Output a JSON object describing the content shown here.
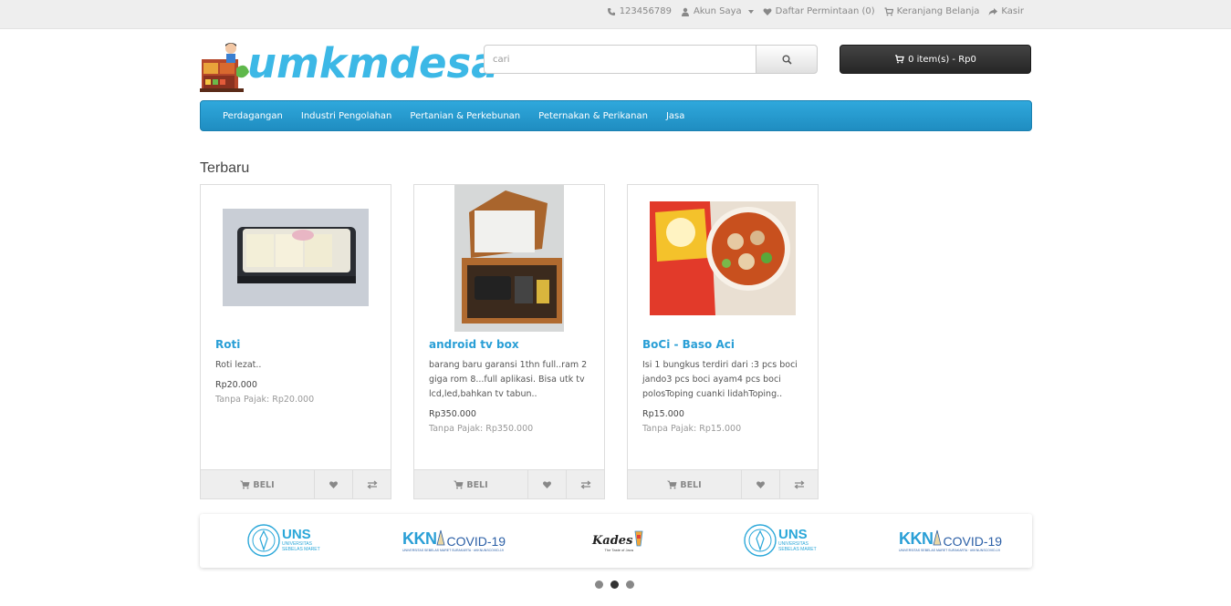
{
  "topbar": {
    "phone": "123456789",
    "account": "Akun Saya",
    "wishlist": "Daftar Permintaan (0)",
    "cart": "Keranjang Belanja",
    "checkout": "Kasir"
  },
  "header": {
    "logo_text": "umkmdesa",
    "search_placeholder": "cari",
    "cart_label": "0 item(s) - Rp0"
  },
  "menu": {
    "items": [
      {
        "label": "Perdagangan"
      },
      {
        "label": "Industri Pengolahan"
      },
      {
        "label": "Pertanian & Perkebunan"
      },
      {
        "label": "Peternakan & Perikanan"
      },
      {
        "label": "Jasa"
      }
    ]
  },
  "section": {
    "title": "Terbaru"
  },
  "products": [
    {
      "name": "Roti",
      "description": "Roti lezat..",
      "price": "Rp20.000",
      "tax": "Tanpa Pajak: Rp20.000",
      "buy_label": "BELI"
    },
    {
      "name": "android tv box",
      "description": "barang baru garansi 1thn full..ram 2 giga rom 8...full aplikasi. Bisa utk tv lcd,led,bahkan tv tabun..",
      "price": "Rp350.000",
      "tax": "Tanpa Pajak: Rp350.000",
      "buy_label": "BELI"
    },
    {
      "name": "BoCi - Baso Aci",
      "description": "Isi 1 bungkus terdiri dari :3 pcs boci jando3 pcs boci ayam4 pcs boci polosToping cuanki lidahToping..",
      "price": "Rp15.000",
      "tax": "Tanpa Pajak: Rp15.000",
      "buy_label": "BELI"
    }
  ],
  "carousel": {
    "uns": {
      "name": "UNS",
      "sub1": "UNIVERSITAS",
      "sub2": "SEBELAS MARET"
    },
    "kkn": {
      "kkn": "KKN",
      "covid": "COVID-19",
      "sub": "UNIVERSITAS SEBELAS MARET SURAKARTA · #KKNUNSCOVID-19"
    },
    "kades": {
      "name": "Kades",
      "sub": "The Taste of Java"
    },
    "active_dot": 1
  },
  "colors": {
    "accent": "#2a9fd6",
    "menu": "#2596cb",
    "cart_button": "#333333"
  }
}
